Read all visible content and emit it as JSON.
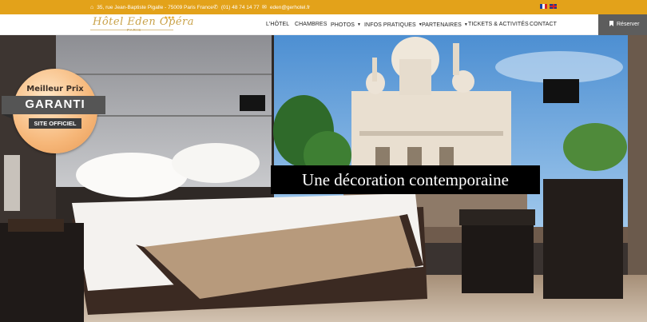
{
  "topbar": {
    "address": "35, rue Jean-Baptiste Pigalle - 75009 Paris France",
    "phone": "(01) 48 74 14 77",
    "email": "eden@gerhotel.fr",
    "languages": [
      "fr",
      "en"
    ]
  },
  "logo": {
    "name": "Hôtel Eden Opéra",
    "stars": "★★★",
    "city": "PARIS"
  },
  "nav": {
    "items": [
      {
        "label": "L'HÔTEL"
      },
      {
        "label": "CHAMBRES"
      },
      {
        "label": "PHOTOS"
      },
      {
        "label": "INFOS PRATIQUES"
      },
      {
        "label": "PARTENAIRES"
      },
      {
        "label": "TICKETS & ACTIVITÉS"
      },
      {
        "label": "CONTACT"
      }
    ],
    "reserve_label": "Réserver"
  },
  "badge": {
    "line1": "Meilleur Prix",
    "line2": "GARANTI",
    "line3": "SITE OFFICIEL"
  },
  "hero": {
    "caption": "Une décoration contemporaine"
  },
  "colors": {
    "accent": "#e3a21a",
    "reserve_bg": "#5d5d5d"
  }
}
